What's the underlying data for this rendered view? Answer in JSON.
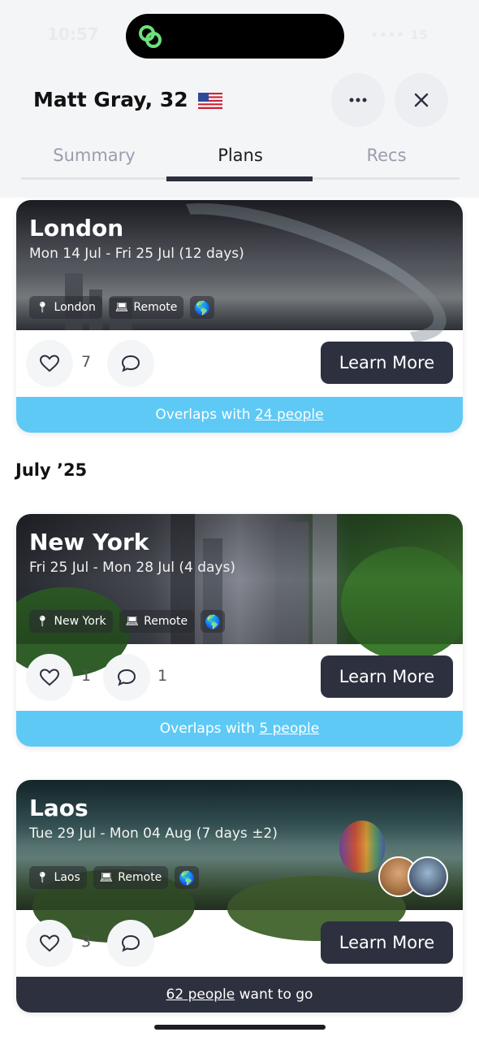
{
  "status_bar": {
    "time": "10:57",
    "right": "•••• 15"
  },
  "header": {
    "name": "Matt Gray, 32",
    "flag": "us-flag-icon",
    "tabs": [
      {
        "label": "Summary",
        "active": false
      },
      {
        "label": "Plans",
        "active": true
      },
      {
        "label": "Recs",
        "active": false
      }
    ]
  },
  "section_july": "July ’25",
  "cards": [
    {
      "city": "London",
      "dates": "Mon 14 Jul - Fri 25 Jul (12 days)",
      "location_chip": "London",
      "work_chip": "Remote",
      "likes": "7",
      "comments": "",
      "learn_more": "Learn More",
      "footer_prefix": "Overlaps with ",
      "footer_link": "24 people",
      "footer_suffix": ""
    },
    {
      "city": "New York",
      "dates": "Fri 25 Jul - Mon 28 Jul (4 days)",
      "location_chip": "New York",
      "work_chip": "Remote",
      "likes": "1",
      "comments": "1",
      "learn_more": "Learn More",
      "footer_prefix": "Overlaps with ",
      "footer_link": "5 people",
      "footer_suffix": ""
    },
    {
      "city": "Laos",
      "dates": "Tue 29 Jul - Mon 04 Aug (7 days ±2)",
      "location_chip": "Laos",
      "work_chip": "Remote",
      "likes": "3",
      "comments": "",
      "learn_more": "Learn More",
      "footer_prefix": "",
      "footer_link": "62 people",
      "footer_suffix": " want to go"
    }
  ],
  "colors": {
    "accent_blue": "#5ec9f5",
    "dark": "#2d303e"
  }
}
